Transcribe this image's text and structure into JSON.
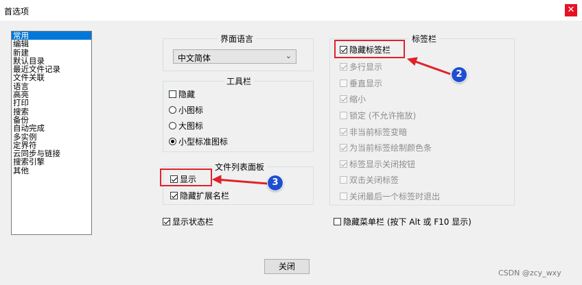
{
  "window": {
    "title": "首选项",
    "close_glyph": "✕"
  },
  "categories": [
    "常用",
    "编辑",
    "新建",
    "默认目录",
    "最近文件记录",
    "文件关联",
    "语言",
    "高亮",
    "打印",
    "搜索",
    "备份",
    "自动完成",
    "多实例",
    "定界符",
    "云同步与链接",
    "搜索引擎",
    "其他"
  ],
  "selected_category": "常用",
  "interface_language": {
    "title": "界面语言",
    "value": "中文简体"
  },
  "toolbar": {
    "title": "工具栏",
    "hide": "隐藏",
    "options": [
      "小图标",
      "大图标",
      "小型标准图标"
    ],
    "selected": "小型标准图标"
  },
  "file_list": {
    "title": "文件列表面板",
    "show": "显示",
    "hide_ext": "隐藏扩展名栏"
  },
  "show_statusbar": "显示状态栏",
  "tabbar": {
    "title": "标签栏",
    "hide": "隐藏标签栏",
    "items": [
      "多行显示",
      "垂直显示",
      "缩小",
      "锁定 (不允许拖放)",
      "非当前标签变暗",
      "为当前标签绘制颜色条",
      "标签显示关闭按钮",
      "双击关闭标签",
      "关闭最后一个标签时退出"
    ],
    "checked": [
      true,
      false,
      true,
      false,
      true,
      true,
      true,
      false,
      false
    ]
  },
  "hide_menubar": "隐藏菜单栏 (按下 Alt 或 F10 显示)",
  "close_button": "关闭",
  "annotations": {
    "badge_2": "2",
    "badge_3": "3",
    "color": "#e0212a"
  },
  "watermark": "CSDN @zcy_wxy"
}
